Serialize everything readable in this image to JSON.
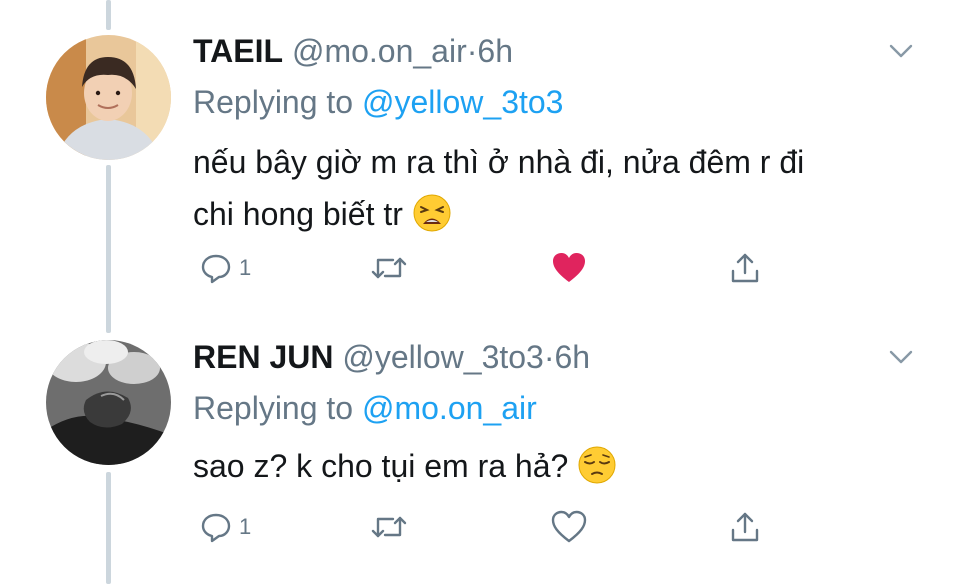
{
  "tweets": [
    {
      "display_name": "TAEIL",
      "handle": "@mo.on_air",
      "separator": "·",
      "time": "6h",
      "replying_prefix": "Replying to",
      "replying_to": "@yellow_3to3",
      "text_line1": "nếu bây giờ m ra thì ở nhà đi, nửa đêm r đi",
      "text_line2": "chi hong biết tr",
      "emoji": "weary-face",
      "reply_count": "1",
      "liked": true
    },
    {
      "display_name": "REN JUN",
      "handle": "@yellow_3to3",
      "separator": "·",
      "time": "6h",
      "replying_prefix": "Replying to",
      "replying_to": "@mo.on_air",
      "text_line1": "sao z? k cho tụi em ra hả?",
      "emoji": "pensive-face",
      "reply_count": "1",
      "liked": false
    }
  ],
  "colors": {
    "like_active": "#e0245e",
    "icon_gray": "#657786",
    "link": "#1da1f2",
    "thread_line": "#ccd6dd"
  }
}
